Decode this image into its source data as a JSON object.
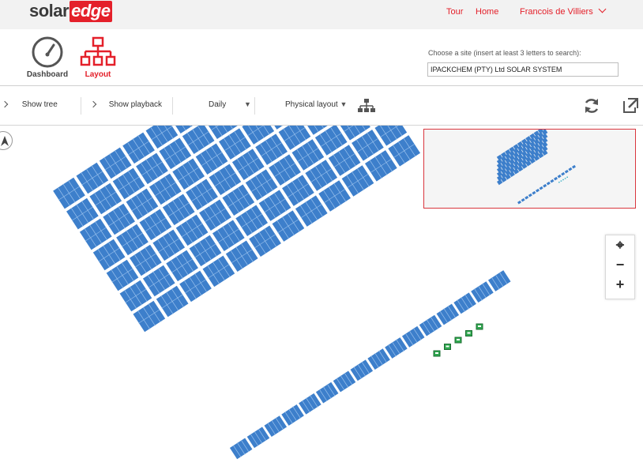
{
  "brand": {
    "part1": "solar",
    "part2": "edge"
  },
  "topnav": {
    "tour": "Tour",
    "home": "Home",
    "user": "Francois de Villiers"
  },
  "nav": {
    "dashboard": "Dashboard",
    "layout": "Layout"
  },
  "site": {
    "label": "Choose a site (insert at least 3 letters to search):",
    "value": "IPACKCHEM (PTY) Ltd SOLAR SYSTEM"
  },
  "toolbar": {
    "show_tree": "Show tree",
    "show_playback": "Show playback",
    "period": "Daily",
    "layout_mode": "Physical layout"
  },
  "map": {
    "compass": "N",
    "array_main": {
      "rows": 7,
      "cols": 12
    },
    "array_strip": {
      "count": 16
    },
    "inverters": {
      "count": 5
    }
  },
  "colors": {
    "accent": "#e4202a",
    "panel": "#3d7fcb",
    "inverter": "#2fa84f"
  },
  "icons": [
    "dashboard-gauge-icon",
    "layout-tree-icon",
    "chevron-down-icon",
    "chevron-right-icon",
    "hierarchy-icon",
    "refresh-icon",
    "popout-icon",
    "locate-icon",
    "zoom-out-icon",
    "zoom-in-icon",
    "compass-icon"
  ]
}
